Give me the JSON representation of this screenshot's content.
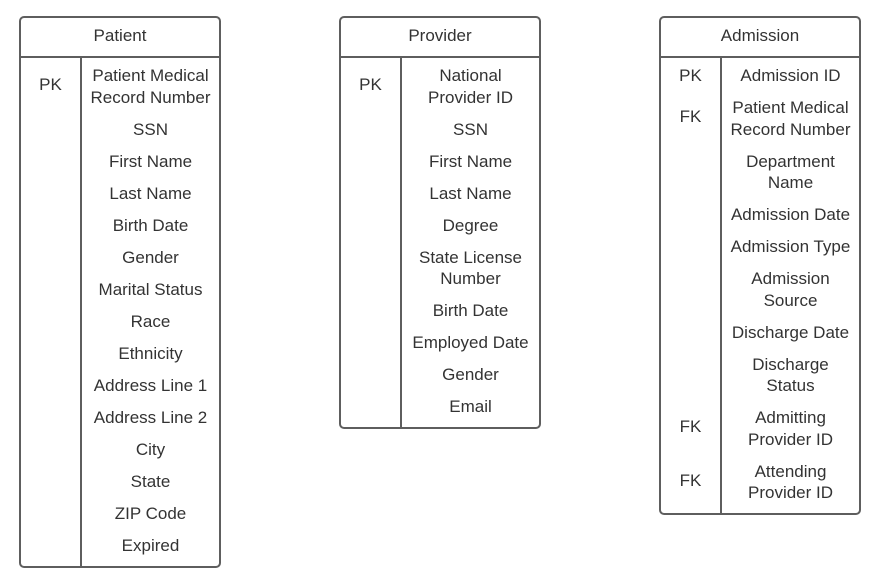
{
  "diagram": {
    "type": "entity-relationship",
    "colors": {
      "border": "#5e5e5e",
      "text": "#333333",
      "background": "#ffffff"
    }
  },
  "entities": {
    "patient": {
      "title": "Patient",
      "attributes": [
        {
          "key": "PK",
          "name": "Patient Medical Record Number"
        },
        {
          "key": "",
          "name": "SSN"
        },
        {
          "key": "",
          "name": "First Name"
        },
        {
          "key": "",
          "name": "Last Name"
        },
        {
          "key": "",
          "name": "Birth Date"
        },
        {
          "key": "",
          "name": "Gender"
        },
        {
          "key": "",
          "name": "Marital Status"
        },
        {
          "key": "",
          "name": "Race"
        },
        {
          "key": "",
          "name": "Ethnicity"
        },
        {
          "key": "",
          "name": "Address Line 1"
        },
        {
          "key": "",
          "name": "Address Line 2"
        },
        {
          "key": "",
          "name": "City"
        },
        {
          "key": "",
          "name": "State"
        },
        {
          "key": "",
          "name": "ZIP Code"
        },
        {
          "key": "",
          "name": "Expired"
        }
      ]
    },
    "provider": {
      "title": "Provider",
      "attributes": [
        {
          "key": "PK",
          "name": "National Provider ID"
        },
        {
          "key": "",
          "name": "SSN"
        },
        {
          "key": "",
          "name": "First Name"
        },
        {
          "key": "",
          "name": "Last Name"
        },
        {
          "key": "",
          "name": "Degree"
        },
        {
          "key": "",
          "name": "State License Number"
        },
        {
          "key": "",
          "name": "Birth Date"
        },
        {
          "key": "",
          "name": "Employed Date"
        },
        {
          "key": "",
          "name": "Gender"
        },
        {
          "key": "",
          "name": "Email"
        }
      ]
    },
    "admission": {
      "title": "Admission",
      "attributes": [
        {
          "key": "PK",
          "name": "Admission ID"
        },
        {
          "key": "FK",
          "name": "Patient Medical Record Number"
        },
        {
          "key": "",
          "name": "Department Name"
        },
        {
          "key": "",
          "name": "Admission Date"
        },
        {
          "key": "",
          "name": "Admission Type"
        },
        {
          "key": "",
          "name": "Admission Source"
        },
        {
          "key": "",
          "name": "Discharge Date"
        },
        {
          "key": "",
          "name": "Discharge Status"
        },
        {
          "key": "FK",
          "name": "Admitting Provider ID"
        },
        {
          "key": "FK",
          "name": "Attending Provider ID"
        }
      ]
    }
  }
}
